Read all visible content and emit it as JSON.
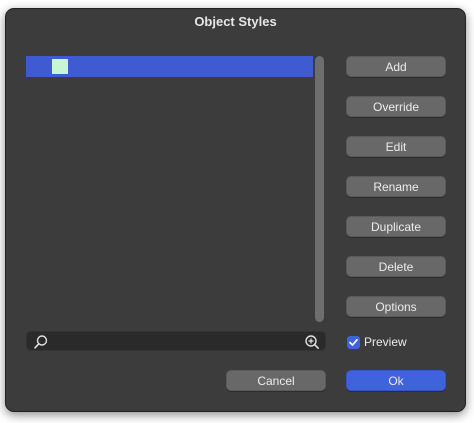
{
  "window": {
    "title": "Object Styles"
  },
  "list": {
    "items": [
      {
        "swatch_color": "#c8f5d6",
        "label": ""
      }
    ],
    "selected_color": "#3e5bd1"
  },
  "search": {
    "value": "",
    "placeholder": ""
  },
  "side_buttons": {
    "add": "Add",
    "override": "Override",
    "edit": "Edit",
    "rename": "Rename",
    "duplicate": "Duplicate",
    "delete": "Delete",
    "options": "Options"
  },
  "preview": {
    "label": "Preview",
    "checked": true
  },
  "footer": {
    "cancel": "Cancel",
    "ok": "Ok"
  },
  "colors": {
    "accent": "#3e63dd",
    "window_bg": "#3c3c3c",
    "button_bg": "#686868"
  }
}
